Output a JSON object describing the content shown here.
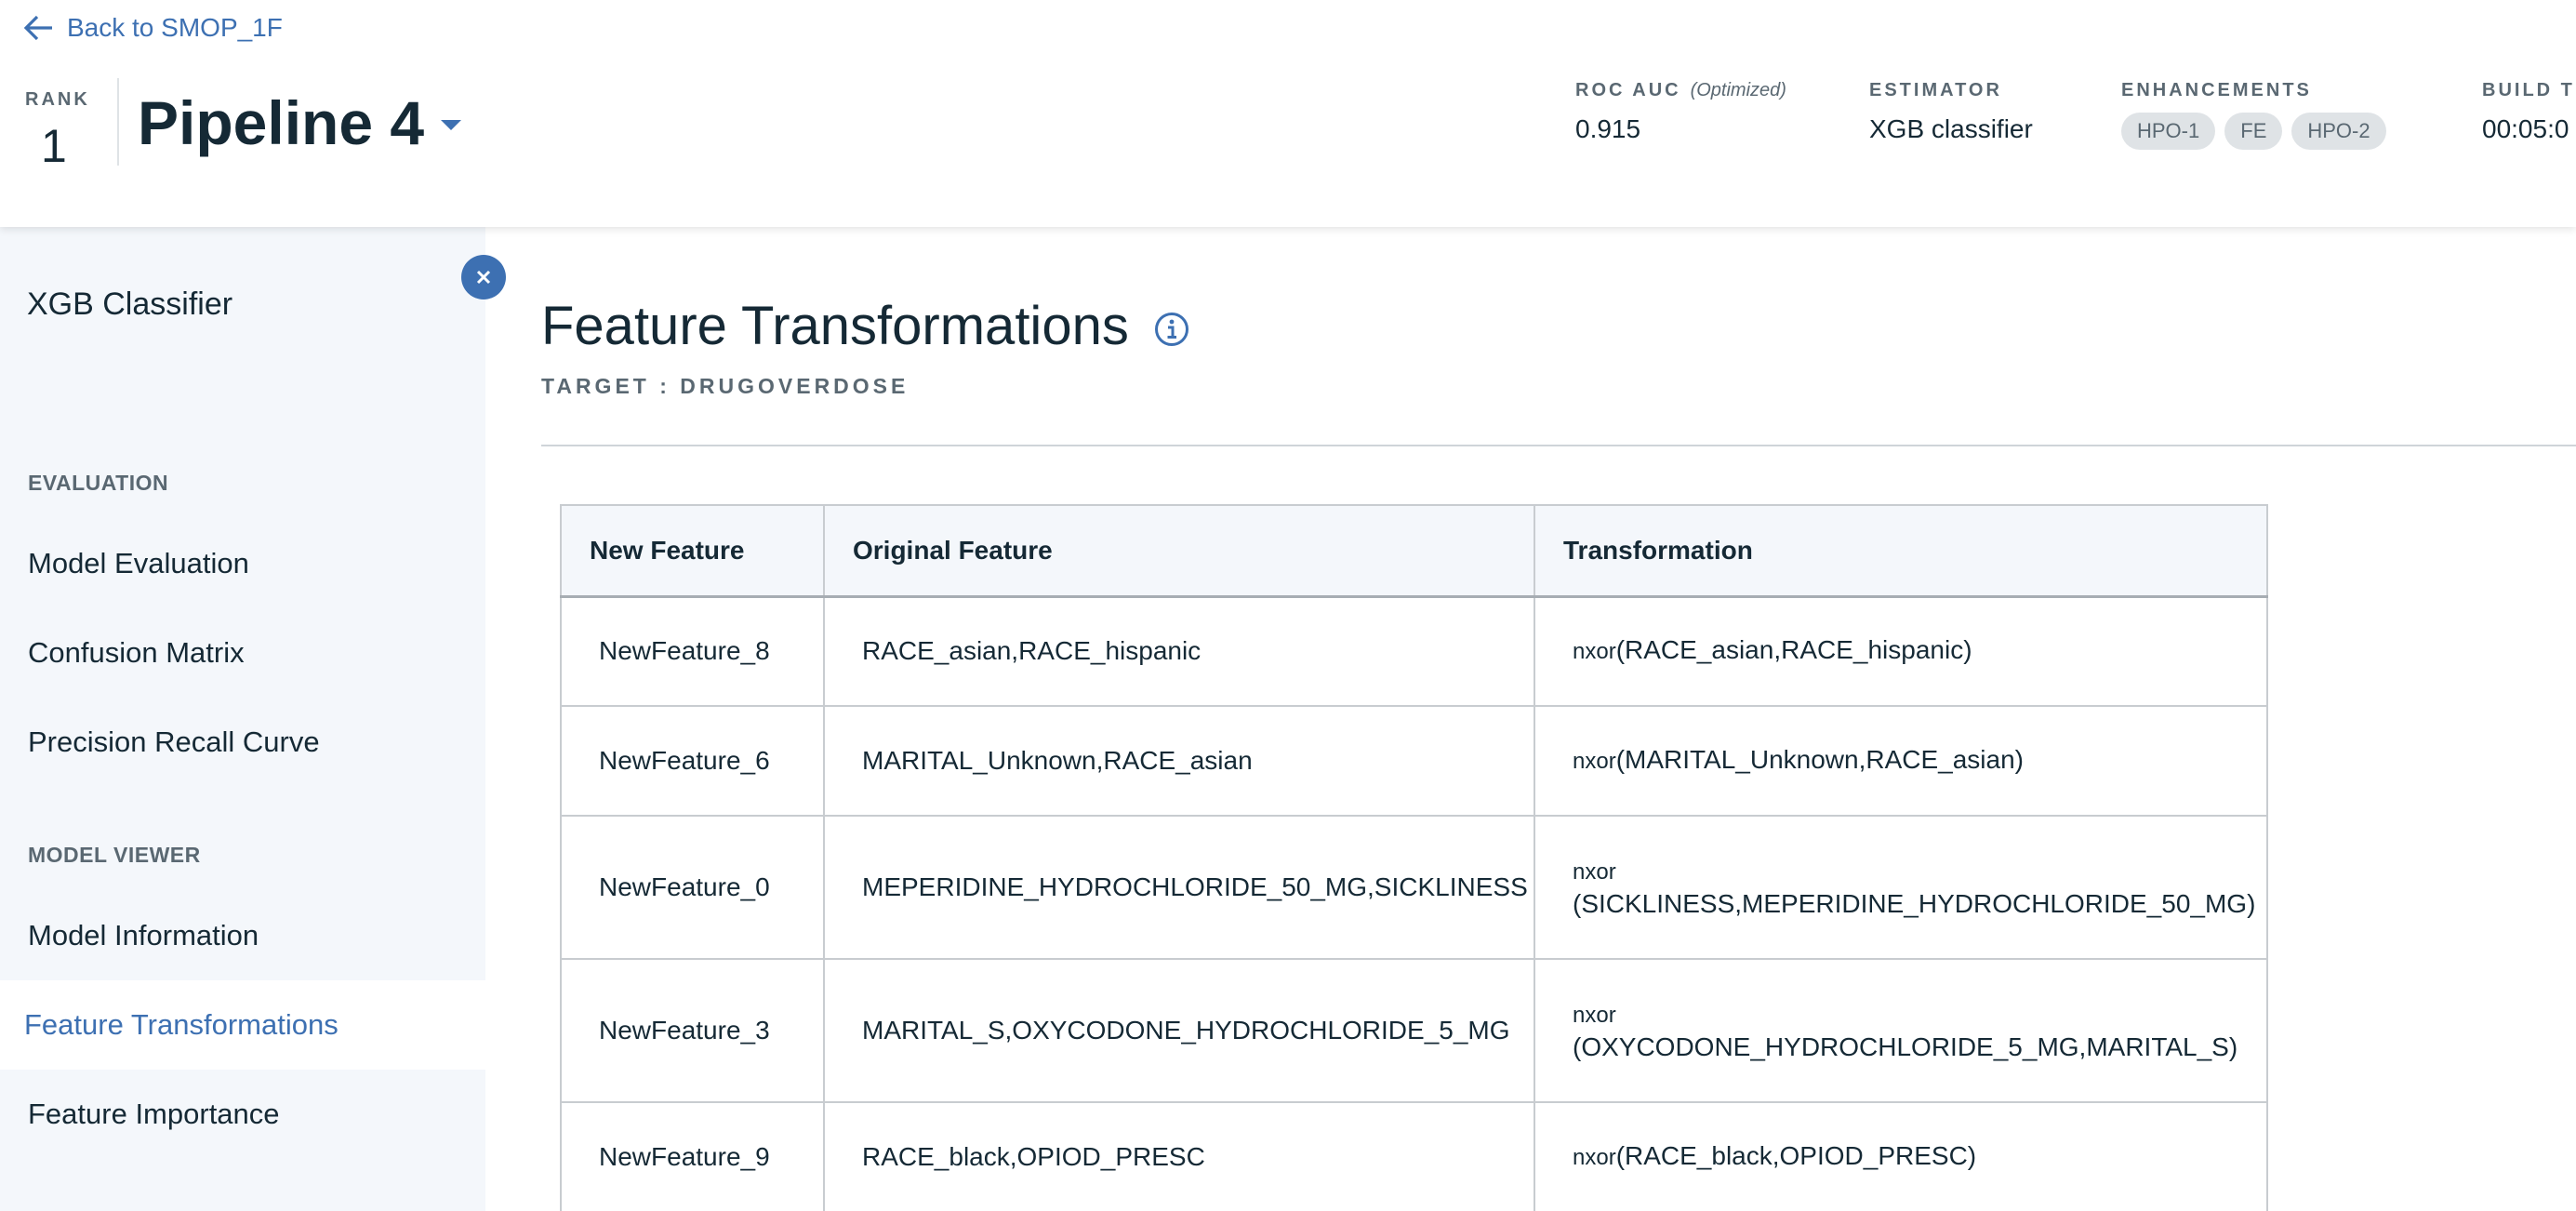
{
  "header": {
    "back_label": "Back to SMOP_1F",
    "rank_label": "RANK",
    "rank_value": "1",
    "pipeline_name": "Pipeline 4",
    "metrics": {
      "roc_label": "ROC AUC",
      "roc_note": "(Optimized)",
      "roc_value": "0.915",
      "estimator_label": "ESTIMATOR",
      "estimator_value": "XGB classifier",
      "enhancements_label": "ENHANCEMENTS",
      "enhancements": [
        "HPO-1",
        "FE",
        "HPO-2"
      ],
      "build_label": "BUILD T",
      "build_value": "00:05:0"
    }
  },
  "sidebar": {
    "title": "XGB Classifier",
    "sections": [
      {
        "label": "EVALUATION",
        "items": [
          "Model Evaluation",
          "Confusion Matrix",
          "Precision Recall Curve"
        ]
      },
      {
        "label": "MODEL VIEWER",
        "items": [
          "Model Information",
          "Feature Transformations",
          "Feature Importance"
        ]
      }
    ],
    "active_item": "Feature Transformations"
  },
  "main": {
    "title": "Feature Transformations",
    "target": "TARGET : DRUGOVERDOSE",
    "table": {
      "headers": [
        "New Feature",
        "Original Feature",
        "Transformation"
      ],
      "rows": [
        {
          "new": "NewFeature_8",
          "orig": "RACE_asian,RACE_hispanic",
          "fn": "nxor",
          "args": "(RACE_asian,RACE_hispanic)"
        },
        {
          "new": "NewFeature_6",
          "orig": "MARITAL_Unknown,RACE_asian",
          "fn": "nxor",
          "args": "(MARITAL_Unknown,RACE_asian)"
        },
        {
          "new": "NewFeature_0",
          "orig": "MEPERIDINE_HYDROCHLORIDE_50_MG,SICKLINESS",
          "fn": "nxor",
          "args": "(SICKLINESS,MEPERIDINE_HYDROCHLORIDE_50_MG)"
        },
        {
          "new": "NewFeature_3",
          "orig": "MARITAL_S,OXYCODONE_HYDROCHLORIDE_5_MG",
          "fn": "nxor",
          "args": "(OXYCODONE_HYDROCHLORIDE_5_MG,MARITAL_S)"
        },
        {
          "new": "NewFeature_9",
          "orig": "RACE_black,OPIOD_PRESC",
          "fn": "nxor",
          "args": "(RACE_black,OPIOD_PRESC)"
        }
      ]
    }
  },
  "colors": {
    "accent": "#3d70b2",
    "sidebar_bg": "#f4f7fb",
    "heading": "#152935",
    "muted": "#5a6872",
    "tag_bg": "#dfe3e6"
  },
  "icons": {
    "back": "arrow-left-icon",
    "dropdown": "caret-down-icon",
    "close": "close-icon",
    "info": "info-icon"
  }
}
